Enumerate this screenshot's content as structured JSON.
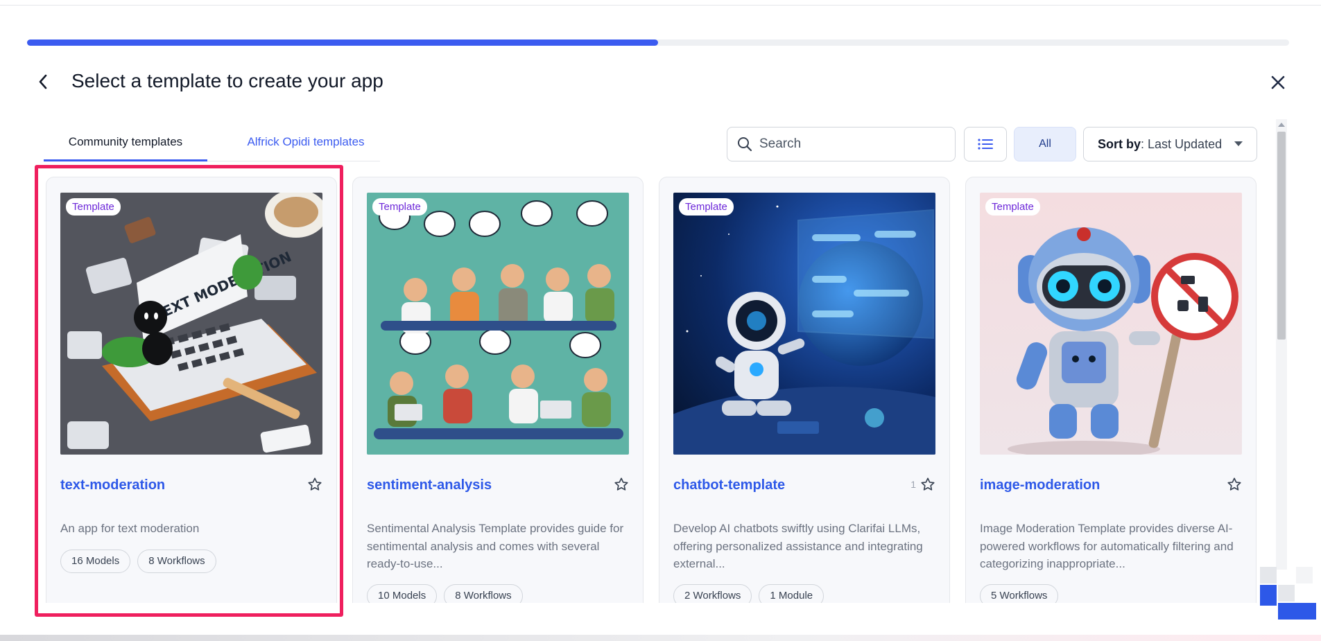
{
  "header": {
    "title": "Select a template to create your app",
    "progress_fraction": 0.5
  },
  "tabs": [
    {
      "label": "Community templates",
      "active": true
    },
    {
      "label": "Alfrick Opidi templates",
      "active": false
    }
  ],
  "toolbar": {
    "search_placeholder": "Search",
    "filter_all_label": "All",
    "sort_prefix": "Sort by",
    "sort_value": ": Last Updated"
  },
  "cards": [
    {
      "badge": "Template",
      "name": "text-moderation",
      "star_count": "",
      "description": "An app for text moderation",
      "chips": [
        "16 Models",
        "8 Workflows"
      ],
      "image_text": "TEXT MODERATION"
    },
    {
      "badge": "Template",
      "name": "sentiment-analysis",
      "star_count": "",
      "description": "Sentimental Analysis Template provides guide for sentimental analysis and comes with several ready-to-use...",
      "chips": [
        "10 Models",
        "8 Workflows"
      ]
    },
    {
      "badge": "Template",
      "name": "chatbot-template",
      "star_count": "1",
      "description": "Develop AI chatbots swiftly using Clarifai LLMs, offering personalized assistance and integrating external...",
      "chips": [
        "2 Workflows",
        "1 Module"
      ]
    },
    {
      "badge": "Template",
      "name": "image-moderation",
      "star_count": "",
      "description": "Image Moderation Template provides diverse AI-powered workflows for automatically filtering and categorizing inappropriate...",
      "chips": [
        "5 Workflows"
      ]
    }
  ],
  "colors": {
    "accent": "#3b5bf0",
    "link": "#2d58e8",
    "highlight": "#ef1f5e",
    "badge_text": "#6d28d9"
  },
  "icons": [
    "back-arrow-icon",
    "close-icon",
    "search-icon",
    "list-view-icon",
    "star-icon",
    "chevron-down-icon"
  ]
}
